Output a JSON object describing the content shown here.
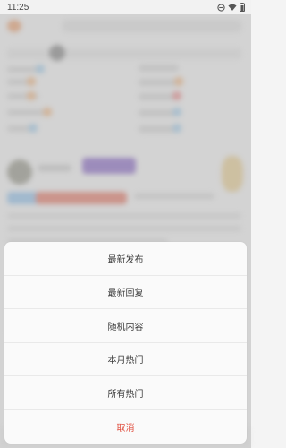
{
  "status_bar": {
    "time": "11:25"
  },
  "action_sheet": {
    "items": [
      {
        "label": "最新发布"
      },
      {
        "label": "最新回复"
      },
      {
        "label": "随机内容"
      },
      {
        "label": "本月热门"
      },
      {
        "label": "所有热门"
      }
    ],
    "cancel_label": "取消",
    "cancel_color": "#e04a3a"
  },
  "colors": {
    "overlay": "#969696",
    "sheet_background": "#fafafa"
  }
}
